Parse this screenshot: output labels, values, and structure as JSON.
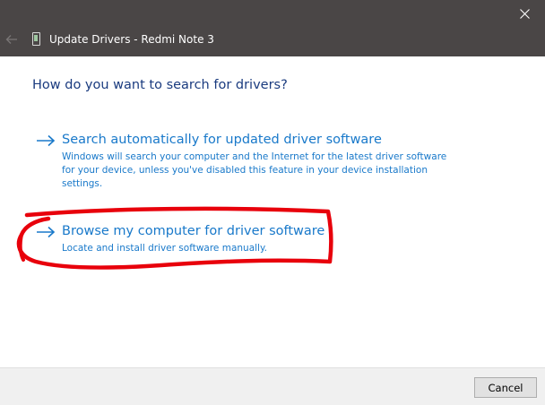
{
  "window": {
    "title": "Update Drivers - Redmi Note 3",
    "close_icon": "close-icon",
    "back_icon": "back-arrow-icon",
    "device_icon": "phone-icon"
  },
  "heading": "How do you want to search for drivers?",
  "options": [
    {
      "title": "Search automatically for updated driver software",
      "description": "Windows will search your computer and the Internet for the latest driver software for your device, unless you've disabled this feature in your device installation settings.",
      "icon": "arrow-right-icon"
    },
    {
      "title": "Browse my computer for driver software",
      "description": "Locate and install driver software manually.",
      "icon": "arrow-right-icon"
    }
  ],
  "footer": {
    "cancel_label": "Cancel"
  },
  "colors": {
    "titlebar": "#4a4646",
    "link": "#1979ca",
    "heading": "#1a3b7f",
    "annotation": "#e8000b"
  }
}
